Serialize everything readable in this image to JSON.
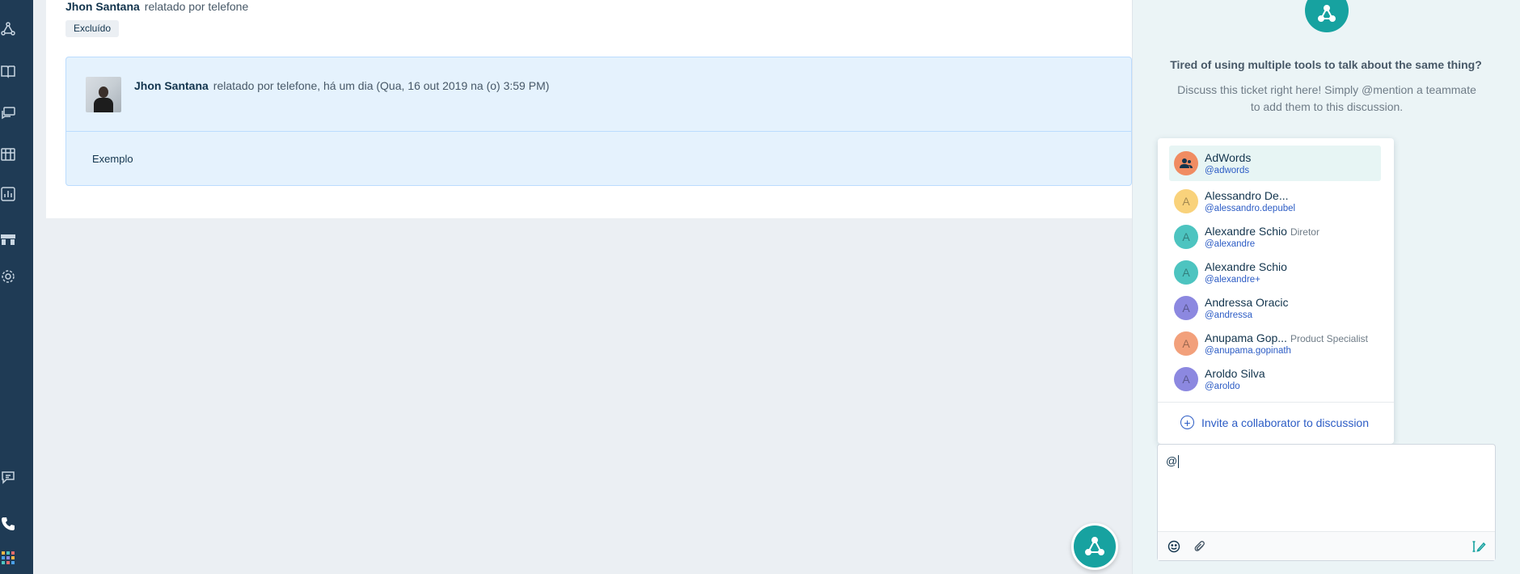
{
  "ticket": {
    "requester_name": "Jhon Santana",
    "requester_via": "relatado por telefone",
    "status_badge": "Excluído",
    "conversation": {
      "author_name": "Jhon Santana",
      "meta": "relatado por telefone, há um dia (Qua, 16 out 2019 na (o) 3:59 PM)",
      "body": "Exemplo"
    }
  },
  "discussion": {
    "title": "Tired of using multiple tools to talk about the same thing?",
    "description": "Discuss this ticket right here! Simply @mention a teammate to add them to this discussion.",
    "composer_value": "@",
    "invite_label": "Invite a collaborator to discussion",
    "mentions": [
      {
        "name": "AdWords",
        "handle": "@adwords",
        "role": "",
        "initial": "",
        "avatar_color": "#f08c62",
        "active": true
      },
      {
        "name": "Alessandro De...",
        "handle": "@alessandro.depubel",
        "role": "",
        "initial": "A",
        "avatar_color": "#f9d27b",
        "active": false
      },
      {
        "name": "Alexandre Schio",
        "handle": "@alexandre",
        "role": "Diretor",
        "initial": "A",
        "avatar_color": "#4dc4c0",
        "active": false
      },
      {
        "name": "Alexandre Schio",
        "handle": "@alexandre+",
        "role": "",
        "initial": "A",
        "avatar_color": "#4dc4c0",
        "active": false
      },
      {
        "name": "Andressa Oracic",
        "handle": "@andressa",
        "role": "",
        "initial": "A",
        "avatar_color": "#8c88e0",
        "active": false
      },
      {
        "name": "Anupama Gop...",
        "handle": "@anupama.gopinath",
        "role": "Product Specialist",
        "initial": "A",
        "avatar_color": "#f2a07b",
        "active": false
      },
      {
        "name": "Aroldo Silva",
        "handle": "@aroldo",
        "role": "",
        "initial": "A",
        "avatar_color": "#8c88e0",
        "active": false
      }
    ]
  },
  "icons": {
    "rail": [
      "social-icon",
      "solutions-book-icon",
      "discussions-icon",
      "analytics-icon",
      "reports-icon",
      "admin-icon",
      "settings-icon",
      "chat-icon",
      "phone-icon",
      "apps-grid-icon"
    ],
    "composer": [
      "emoji-icon",
      "attachment-icon",
      "signature-icon"
    ],
    "brand": "discuss-triangle-icon"
  },
  "colors": {
    "rail": "#1f3b55",
    "accent_teal": "#17a2a0",
    "link_blue": "#2c5cc5"
  }
}
